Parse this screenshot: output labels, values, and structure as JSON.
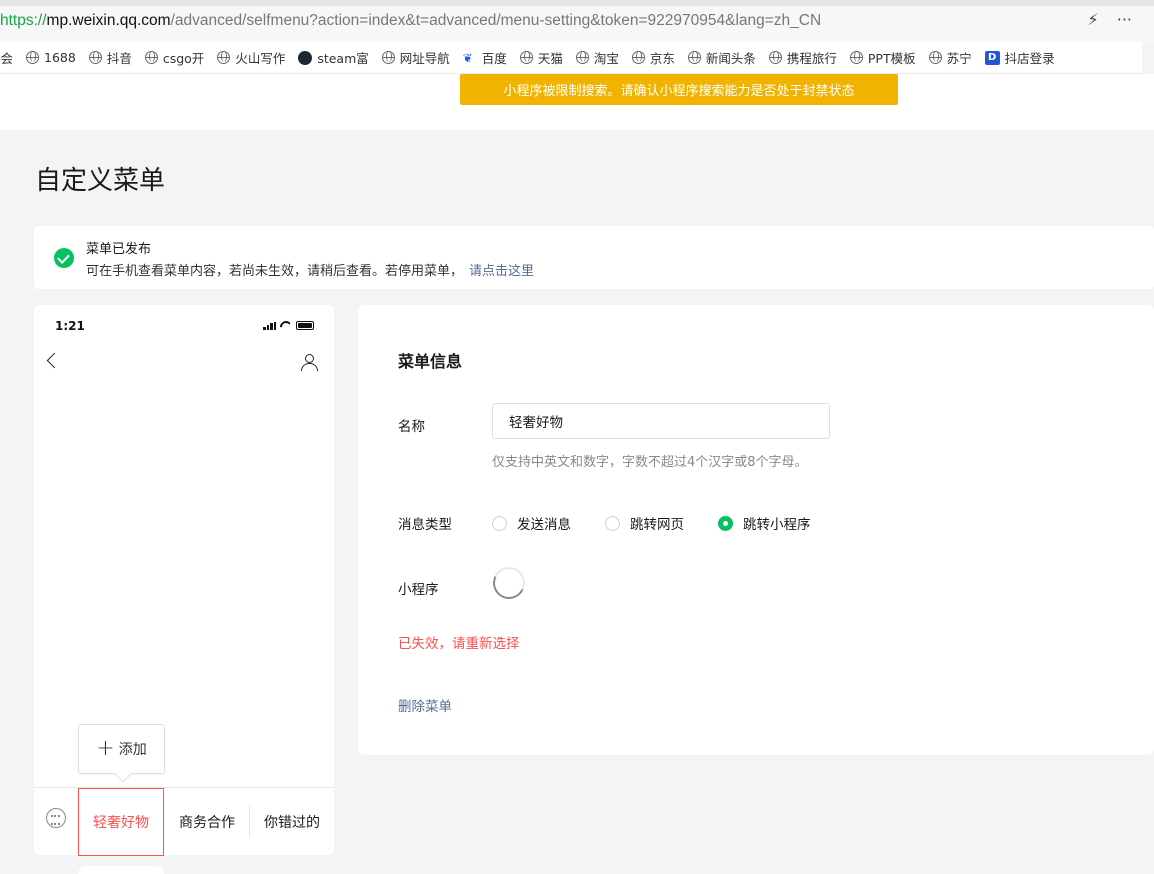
{
  "browser": {
    "url_scheme": "https://",
    "url_host": "mp.weixin.qq.com",
    "url_path": "/advanced/selfmenu?action=index&t=advanced/menu-setting&token=922970954&lang=zh_CN",
    "bookmarks": [
      {
        "label": "舔会",
        "icon": "globe-icon"
      },
      {
        "label": "1688",
        "icon": "globe-icon"
      },
      {
        "label": "抖音",
        "icon": "globe-icon"
      },
      {
        "label": "csgo开",
        "icon": "globe-icon"
      },
      {
        "label": "火山写作",
        "icon": "globe-icon"
      },
      {
        "label": "steam富",
        "icon": "steam-icon"
      },
      {
        "label": "网址导航",
        "icon": "globe-icon"
      },
      {
        "label": "百度",
        "icon": "baidu-paw-icon"
      },
      {
        "label": "天猫",
        "icon": "globe-icon"
      },
      {
        "label": "淘宝",
        "icon": "globe-icon"
      },
      {
        "label": "京东",
        "icon": "globe-icon"
      },
      {
        "label": "新闻头条",
        "icon": "globe-icon"
      },
      {
        "label": "携程旅行",
        "icon": "globe-icon"
      },
      {
        "label": "PPT模板",
        "icon": "globe-icon"
      },
      {
        "label": "苏宁",
        "icon": "globe-icon"
      },
      {
        "label": "抖店登录",
        "icon": "doudian-icon"
      }
    ]
  },
  "banner": {
    "warning": "小程序被限制搜索。请确认小程序搜索能力是否处于封禁状态",
    "color": "#f0b400"
  },
  "page": {
    "title": "自定义菜单"
  },
  "notice": {
    "title": "菜单已发布",
    "body": "可在手机查看菜单内容，若尚未生效，请稍后查看。若停用菜单，",
    "link": "请点击这里"
  },
  "phone": {
    "time": "1:21",
    "add_label": "添加",
    "menu": [
      {
        "label": "轻奢好物",
        "active": true
      },
      {
        "label": "商务合作",
        "active": false
      },
      {
        "label": "你错过的",
        "active": false
      }
    ]
  },
  "editor": {
    "section_title": "菜单信息",
    "name_label": "名称",
    "name_value": "轻奢好物",
    "name_hint": "仅支持中英文和数字，字数不超过4个汉字或8个字母。",
    "type_label": "消息类型",
    "types": [
      {
        "label": "发送消息",
        "selected": false
      },
      {
        "label": "跳转网页",
        "selected": false
      },
      {
        "label": "跳转小程序",
        "selected": true
      }
    ],
    "miniprogram_label": "小程序",
    "error": "已失效，请重新选择",
    "delete_label": "删除菜单"
  },
  "colors": {
    "accent": "#07c160",
    "error": "#fa5151",
    "link": "#576b95"
  }
}
